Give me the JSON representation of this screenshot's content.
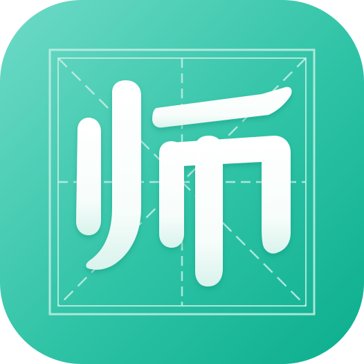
{
  "icon": {
    "character": "师",
    "colors": {
      "background_top_left": "#66d7c3",
      "background_bottom_right": "#0eb292",
      "grid_lines": "#b9ece1",
      "glyph_fill": "#ffffff",
      "glyph_fill_bottom": "#dff5ef"
    }
  }
}
